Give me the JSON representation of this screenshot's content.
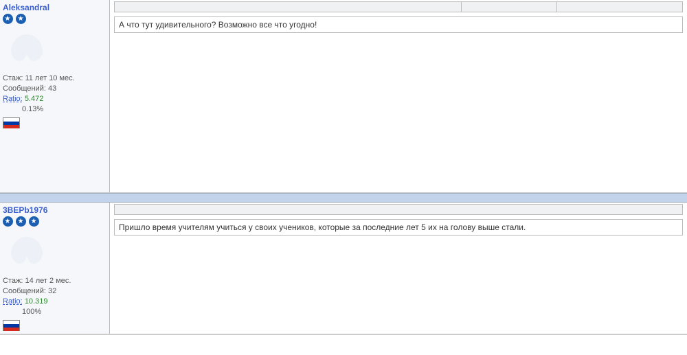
{
  "posts": [
    {
      "username": "Aleksandral",
      "stars": 2,
      "seniority_label": "Стаж:",
      "seniority_value": "11 лет 10 мес.",
      "messages_label": "Сообщений:",
      "messages_value": "43",
      "ratio_label": "Ratio:",
      "ratio_value": "5.472",
      "percent": "0.13%",
      "flag": "russia",
      "message": "А что тут удивительного? Возможно все что угодно!"
    },
    {
      "username": "3BEPb1976",
      "stars": 3,
      "seniority_label": "Стаж:",
      "seniority_value": "14 лет 2 мес.",
      "messages_label": "Сообщений:",
      "messages_value": "32",
      "ratio_label": "Ratio:",
      "ratio_value": "10.319",
      "percent": "100%",
      "flag": "russia",
      "message": "Пришло время учителям учиться у своих учеников, которые за последние лет 5 их на голову выше стали."
    }
  ]
}
